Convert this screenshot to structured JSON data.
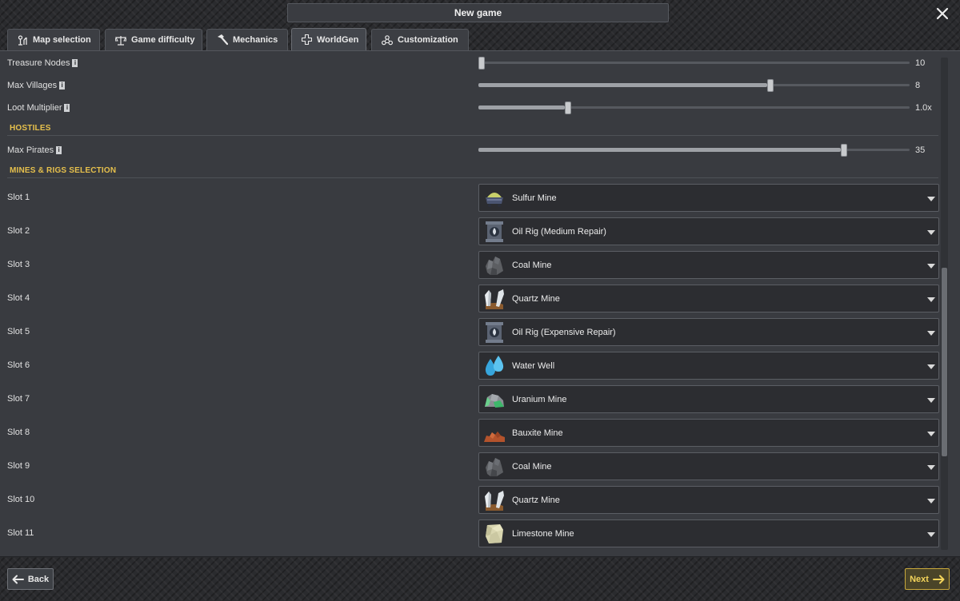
{
  "window": {
    "title": "New game",
    "close_icon": "close-icon"
  },
  "tabs": [
    {
      "label": "Map selection",
      "icon": "map-icon",
      "active": false
    },
    {
      "label": "Game difficulty",
      "icon": "balance-scale-icon",
      "active": false
    },
    {
      "label": "Mechanics",
      "icon": "hammer-icon",
      "active": false
    },
    {
      "label": "WorldGen",
      "icon": "plus-cross-icon",
      "active": true
    },
    {
      "label": "Customization",
      "icon": "molecule-icon",
      "active": false
    }
  ],
  "settings": [
    {
      "label": "Treasure Nodes",
      "value": "10",
      "level": 0.0
    },
    {
      "label": "Max Villages",
      "value": "8",
      "level": 0.67
    },
    {
      "label": "Loot Multiplier",
      "value": "1.0x",
      "level": 0.2
    }
  ],
  "hostiles": {
    "title": "HOSTILES",
    "settings": [
      {
        "label": "Max Pirates",
        "value": "35",
        "level": 0.84
      }
    ]
  },
  "mines": {
    "title": "MINES & RIGS SELECTION",
    "slots": [
      {
        "label": "Slot 1",
        "value": "Sulfur Mine",
        "icon": "sulfur-cart-icon"
      },
      {
        "label": "Slot 2",
        "value": "Oil Rig (Medium Repair)",
        "icon": "oil-rig-icon"
      },
      {
        "label": "Slot 3",
        "value": "Coal Mine",
        "icon": "coal-icon"
      },
      {
        "label": "Slot 4",
        "value": "Quartz Mine",
        "icon": "quartz-icon"
      },
      {
        "label": "Slot 5",
        "value": "Oil Rig (Expensive Repair)",
        "icon": "oil-rig-icon"
      },
      {
        "label": "Slot 6",
        "value": "Water Well",
        "icon": "water-drops-icon"
      },
      {
        "label": "Slot 7",
        "value": "Uranium Mine",
        "icon": "uranium-rock-icon"
      },
      {
        "label": "Slot 8",
        "value": "Bauxite Mine",
        "icon": "bauxite-pile-icon"
      },
      {
        "label": "Slot 9",
        "value": "Coal Mine",
        "icon": "coal-icon"
      },
      {
        "label": "Slot 10",
        "value": "Quartz Mine",
        "icon": "quartz-icon"
      },
      {
        "label": "Slot 11",
        "value": "Limestone Mine",
        "icon": "limestone-icon"
      }
    ]
  },
  "footer": {
    "back_label": "Back",
    "next_label": "Next"
  },
  "colors": {
    "accent": "#e6c04c",
    "panel": "#393b40",
    "dropdown": "#2c2d31"
  }
}
